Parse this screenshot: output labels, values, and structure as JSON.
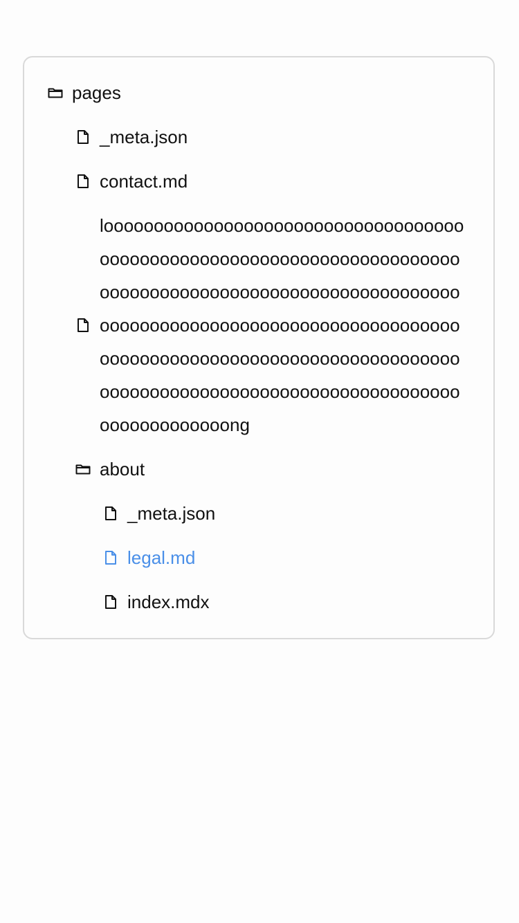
{
  "accent_color": "#4a8fe8",
  "tree": {
    "root": {
      "label": "pages",
      "icon": "folder-icon"
    },
    "pages_children": [
      {
        "label": "_meta.json",
        "icon": "file-icon"
      },
      {
        "label": "contact.md",
        "icon": "file-icon"
      },
      {
        "label": "looooooooooooooooooooooooooooooooooooooooooooooooooooooooooooooooooooooooooooooooooooooooooooooooooooooooooooooooooooooooooooooooooooooooooooooooooooooooooooooooooooooooooooooooooooooooooooooooooooooooooooooooooooooooooooooooooooong",
        "icon": "file-icon"
      }
    ],
    "about": {
      "label": "about",
      "icon": "folder-icon"
    },
    "about_children": [
      {
        "label": "_meta.json",
        "icon": "file-icon"
      },
      {
        "label": "legal.md",
        "icon": "file-icon",
        "active": true
      },
      {
        "label": "index.mdx",
        "icon": "file-icon"
      }
    ]
  }
}
